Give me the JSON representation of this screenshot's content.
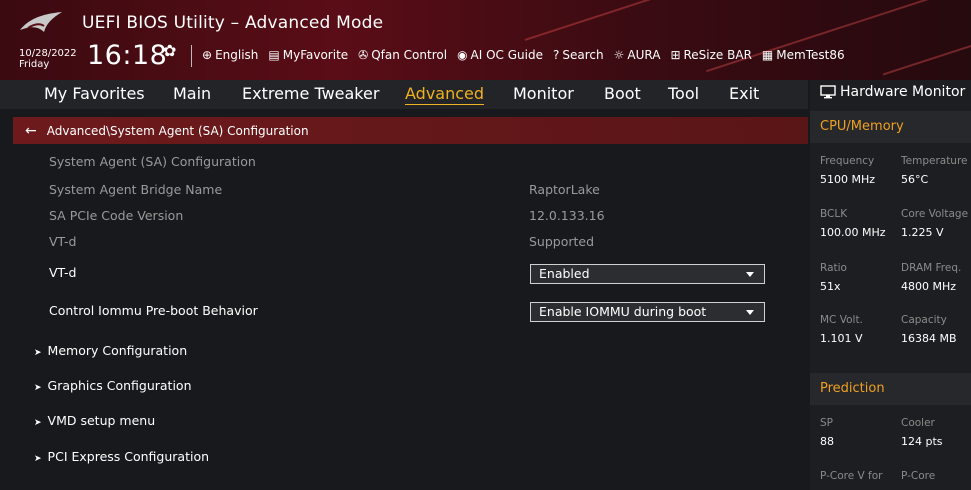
{
  "header": {
    "app_title": "UEFI BIOS Utility – Advanced Mode",
    "date": "10/28/2022",
    "day": "Friday",
    "time": "16:18",
    "tools": [
      {
        "icon": "globe-icon",
        "glyph": "⊕",
        "label": "English"
      },
      {
        "icon": "favorite-icon",
        "glyph": "▤",
        "label": "MyFavorite"
      },
      {
        "icon": "fan-icon",
        "glyph": "✇",
        "label": "Qfan Control"
      },
      {
        "icon": "ai-oc-icon",
        "glyph": "◉",
        "label": "AI OC Guide"
      },
      {
        "icon": "search-icon",
        "glyph": "?",
        "label": "Search"
      },
      {
        "icon": "aura-icon",
        "glyph": "☼",
        "label": "AURA"
      },
      {
        "icon": "resize-bar-icon",
        "glyph": "⊞",
        "label": "ReSize BAR"
      },
      {
        "icon": "memtest-icon",
        "glyph": "▦",
        "label": "MemTest86"
      }
    ]
  },
  "nav": {
    "items": [
      "My Favorites",
      "Main",
      "Extreme Tweaker",
      "Advanced",
      "Monitor",
      "Boot",
      "Tool",
      "Exit"
    ],
    "active": "Advanced"
  },
  "breadcrumb": "Advanced\\System Agent (SA) Configuration",
  "content": {
    "section_title": "System Agent (SA) Configuration",
    "info": [
      {
        "label": "System Agent Bridge Name",
        "value": "RaptorLake"
      },
      {
        "label": "SA PCIe Code Version",
        "value": "12.0.133.16"
      },
      {
        "label": "VT-d",
        "value": "Supported"
      }
    ],
    "settings": [
      {
        "label": "VT-d",
        "value": "Enabled"
      },
      {
        "label": "Control Iommu Pre-boot Behavior",
        "value": "Enable IOMMU during boot"
      }
    ],
    "submenus": [
      "Memory Configuration",
      "Graphics Configuration",
      "VMD setup menu",
      "PCI Express Configuration"
    ]
  },
  "hw_monitor": {
    "title": "Hardware Monitor",
    "cpu_memory": {
      "title": "CPU/Memory",
      "items": [
        {
          "label": "Frequency",
          "value": "5100 MHz"
        },
        {
          "label": "Temperature",
          "value": "56°C"
        },
        {
          "label": "BCLK",
          "value": "100.00 MHz"
        },
        {
          "label": "Core Voltage",
          "value": "1.225 V"
        },
        {
          "label": "Ratio",
          "value": "51x"
        },
        {
          "label": "DRAM Freq.",
          "value": "4800 MHz"
        },
        {
          "label": "MC Volt.",
          "value": "1.101 V"
        },
        {
          "label": "Capacity",
          "value": "16384 MB"
        }
      ]
    },
    "prediction": {
      "title": "Prediction",
      "items": [
        {
          "label": "SP",
          "value": "88"
        },
        {
          "label": "Cooler",
          "value": "124 pts"
        },
        {
          "label": "P-Core V for",
          "value": ""
        },
        {
          "label": "P-Core",
          "value": ""
        }
      ]
    }
  },
  "colors": {
    "accent": "#f0b020",
    "header_red": "#5a0d16",
    "breadcrumb_red": "#6e1a1c",
    "background": "#17191c"
  }
}
